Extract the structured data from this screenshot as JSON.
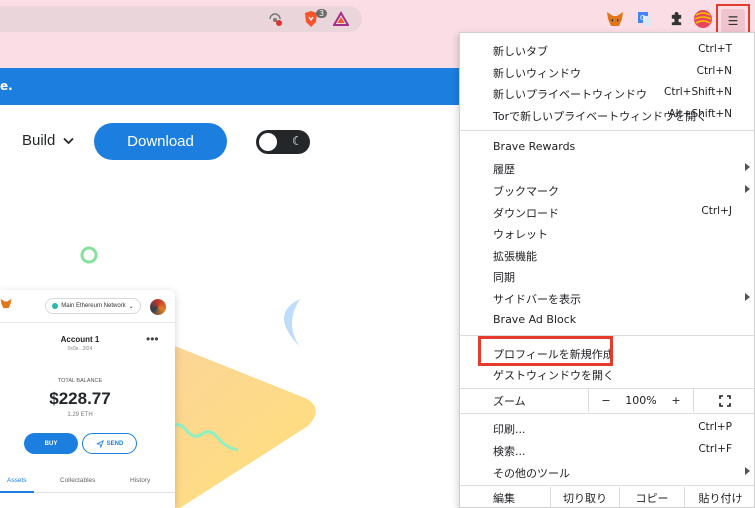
{
  "banner": {
    "text": "e."
  },
  "nav": {
    "build_label": "Build",
    "download_label": "Download"
  },
  "toolbar": {
    "brave_badge": "3"
  },
  "wallet": {
    "network": "Main Ethereum Network",
    "account_name": "Account 1",
    "account_address": "0x0e...3f24",
    "total_balance_label": "TOTAL BALANCE",
    "balance": "$228.77",
    "eth_amount": "1.29 ETH",
    "buy_label": "BUY",
    "send_label": "SEND",
    "tabs": [
      {
        "label": "Assets"
      },
      {
        "label": "Collectables"
      },
      {
        "label": "History"
      }
    ]
  },
  "menu": {
    "group1": [
      {
        "label": "新しいタブ",
        "shortcut": "Ctrl+T"
      },
      {
        "label": "新しいウィンドウ",
        "shortcut": "Ctrl+N"
      },
      {
        "label": "新しいプライベートウィンドウ",
        "shortcut": "Ctrl+Shift+N"
      },
      {
        "label": "Torで新しいプライベートウィンドウを開く",
        "shortcut": "Alt+Shift+N"
      }
    ],
    "group2": [
      {
        "label": "Brave Rewards",
        "shortcut": "",
        "submenu": false
      },
      {
        "label": "履歴",
        "shortcut": "",
        "submenu": true
      },
      {
        "label": "ブックマーク",
        "shortcut": "",
        "submenu": true
      },
      {
        "label": "ダウンロード",
        "shortcut": "Ctrl+J",
        "submenu": false
      },
      {
        "label": "ウォレット",
        "shortcut": "",
        "submenu": false
      },
      {
        "label": "拡張機能",
        "shortcut": "",
        "submenu": false
      },
      {
        "label": "同期",
        "shortcut": "",
        "submenu": false
      },
      {
        "label": "サイドバーを表示",
        "shortcut": "",
        "submenu": true
      },
      {
        "label": "Brave Ad Block",
        "shortcut": "",
        "submenu": false
      }
    ],
    "group3": [
      {
        "label": "プロフィールを新規作成"
      },
      {
        "label": "ゲストウィンドウを開く"
      }
    ],
    "zoom": {
      "label": "ズーム",
      "minus": "−",
      "value": "100%",
      "plus": "+"
    },
    "group4": [
      {
        "label": "印刷...",
        "shortcut": "Ctrl+P",
        "submenu": false
      },
      {
        "label": "検索...",
        "shortcut": "Ctrl+F",
        "submenu": false
      },
      {
        "label": "その他のツール",
        "shortcut": "",
        "submenu": true
      }
    ],
    "edit": {
      "label": "編集",
      "cut": "切り取り",
      "copy": "コピー",
      "paste": "貼り付け"
    }
  },
  "colors": {
    "accent": "#1c7fe0",
    "highlight": "#e53b2d",
    "toolbar": "#fbdde6"
  }
}
